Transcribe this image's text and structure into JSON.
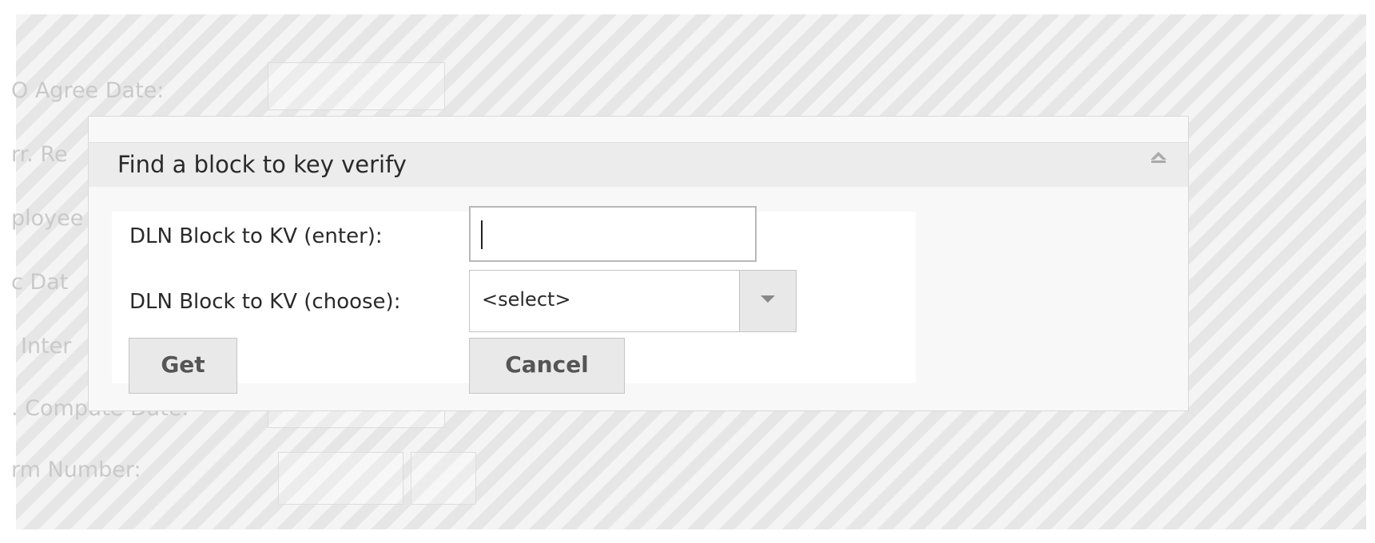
{
  "background_form": {
    "labels": [
      "O Agree Date:",
      "rr. Re",
      "ployee",
      "c Dat",
      "Inter",
      ". Compute Date:",
      "rm Number:"
    ]
  },
  "dialog": {
    "title": "Find a block to key verify",
    "close_icon": "collapse-icon",
    "fields": {
      "enter_label": "DLN Block to KV (enter):",
      "enter_value": "",
      "choose_label": "DLN Block to KV (choose):",
      "choose_selected": "<select>"
    },
    "buttons": {
      "get_label": "Get",
      "cancel_label": "Cancel"
    }
  },
  "colors": {
    "overlay_stripe_light": "#f4f4f4",
    "overlay_stripe_dark": "#e6e6e6",
    "dialog_header": "#ececec",
    "button_bg": "#e9e9e9"
  }
}
